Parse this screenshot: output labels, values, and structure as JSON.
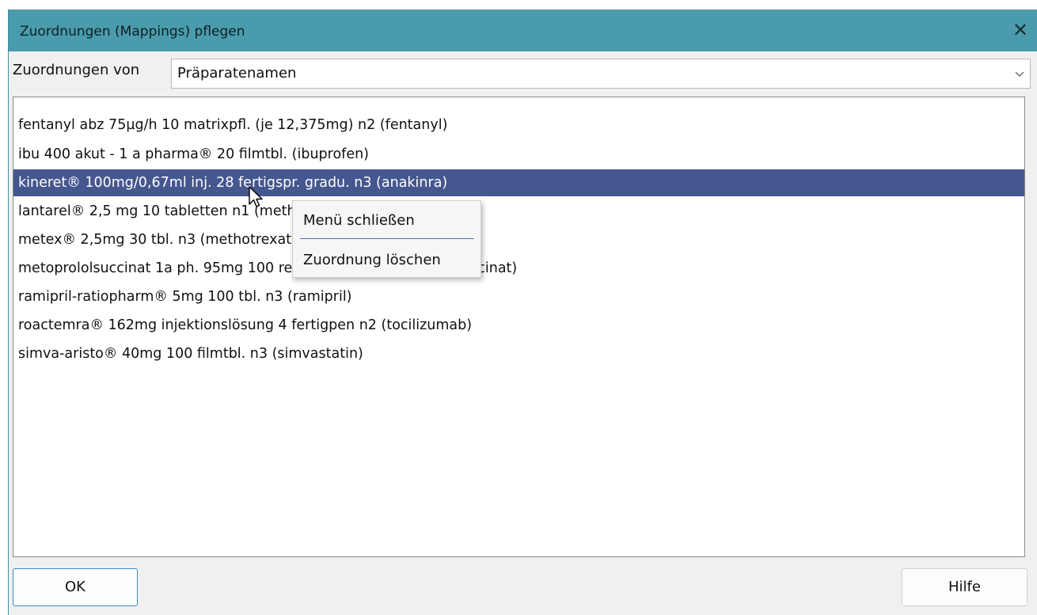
{
  "window": {
    "title": "Zuordnungen (Mappings) pflegen",
    "close_glyph": "✕"
  },
  "filter": {
    "label": "Zuordnungen von",
    "selected": "Präparatenamen"
  },
  "mappings": {
    "items": [
      "fentanyl abz 75µg/h 10 matrixpfl. (je 12,375mg) n2 (fentanyl)",
      "ibu 400 akut - 1 a pharma® 20 filmtbl. (ibuprofen)",
      "kineret® 100mg/0,67ml inj. 28 fertigspr. gradu. n3 (anakinra)",
      "lantarel® 2,5 mg 10 tabletten n1 (methotrexat)",
      "metex® 2,5mg 30 tbl. n3 (methotrexat)",
      "metoprololsuccinat 1a ph. 95mg 100 retardtbl. n3 (metoprolol succinat)",
      "ramipril-ratiopharm® 5mg 100 tbl. n3 (ramipril)",
      "roactemra® 162mg injektionslösung 4 fertigpen n2 (tocilizumab)",
      "simva-aristo® 40mg 100 filmtbl. n3 (simvastatin)"
    ],
    "selected_index": 2
  },
  "context_menu": {
    "items": [
      "Menü schließen",
      "Zuordnung löschen"
    ]
  },
  "buttons": {
    "ok": "OK",
    "help": "Hilfe"
  },
  "colors": {
    "titlebar": "#4a9cac",
    "selection": "#45578f",
    "ok_border": "#3c88c8"
  },
  "icons": {
    "close": "close-icon",
    "dropdown": "chevron-down-icon",
    "cursor": "mouse-pointer-icon"
  }
}
